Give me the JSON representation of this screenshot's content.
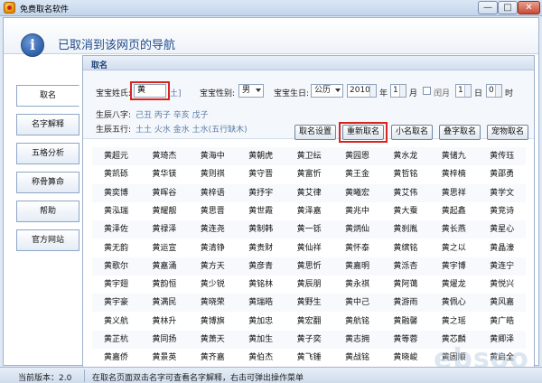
{
  "window": {
    "title": "免费取名软件",
    "icon": "app-logo-icon",
    "controls": [
      "—",
      "□",
      "✕"
    ]
  },
  "nav_banner": {
    "message": "已取消到该网页的导航",
    "icon": "info-icon",
    "icon_glyph": "i"
  },
  "sidebar": {
    "items": [
      {
        "label": "取名",
        "active": true
      },
      {
        "label": "名字解释",
        "active": false
      },
      {
        "label": "五格分析",
        "active": false
      },
      {
        "label": "称骨算命",
        "active": false
      },
      {
        "label": "帮助",
        "active": false
      },
      {
        "label": "官方网站",
        "active": false
      }
    ]
  },
  "panel": {
    "title": "取名",
    "surname_label": "宝宝姓氏:",
    "surname_value": "黄",
    "surname_hint": "土]",
    "gender_label": "宝宝性别:",
    "gender_value": "男",
    "birth_label": "宝宝生日:",
    "calendar_value": "公历",
    "year_value": "2010",
    "year_unit": "年",
    "month_value": "1",
    "month_unit": "月",
    "leap_label": "闰月",
    "day_value": "1",
    "day_unit": "日",
    "hour_value": "0",
    "hour_unit": "时",
    "bazi_label": "生辰八字:",
    "bazi_value": "己丑 丙子 辛亥 戊子",
    "wuxing_label": "生辰五行:",
    "wuxing_value": "土土 火水 金水 土水(五行缺木)",
    "buttons": [
      "取名设置",
      "重新取名",
      "小名取名",
      "叠字取名",
      "宠物取名"
    ],
    "highlighted_button": "重新取名"
  },
  "names": [
    [
      "黄超元",
      "黄琦杰",
      "黄海中",
      "黄朝虎",
      "黄卫纭",
      "黄园恩",
      "黄水龙",
      "黄储九",
      "黄传珏"
    ],
    [
      "黄凯砾",
      "黄华镁",
      "黄则祺",
      "黄守晋",
      "黄富忻",
      "黄王金",
      "黄哲铭",
      "黄梓楠",
      "黄邵勇"
    ],
    [
      "黄奕博",
      "黄晖谷",
      "黄梓语",
      "黄抒宇",
      "黄艾律",
      "黄曦宏",
      "黄艾伟",
      "黄思祥",
      "黄学文"
    ],
    [
      "黄泓瑞",
      "黄耀靓",
      "黄思晋",
      "黄世霞",
      "黄泽嘉",
      "黄兆中",
      "黄大蚕",
      "黄起鑫",
      "黄竞诗"
    ],
    [
      "黄泽佐",
      "黄禄泽",
      "黄连尧",
      "黄制韩",
      "黄一铄",
      "黄炳仙",
      "黄刹胤",
      "黄长燕",
      "黄星心"
    ],
    [
      "黄无韵",
      "黄运宣",
      "黄清铮",
      "黄贵财",
      "黄仙祥",
      "黄怀泰",
      "黄缤铭",
      "黄之以",
      "黄晶濠"
    ],
    [
      "黄歌尔",
      "黄嘉涌",
      "黄方天",
      "黄彦青",
      "黄思忻",
      "黄嘉明",
      "黄泺杏",
      "黄宇博",
      "黄连宁"
    ],
    [
      "黄宇翅",
      "黄韵恒",
      "黄少锐",
      "黄铭林",
      "黄辰朋",
      "黄永祺",
      "黄阿蔼",
      "黄燿龙",
      "黄悦兴"
    ],
    [
      "黄宇豪",
      "黄满民",
      "黄晓荣",
      "黄瑞皓",
      "黄野生",
      "黄中己",
      "黄游雨",
      "黄佩心",
      "黄风嘉"
    ],
    [
      "黄义航",
      "黄林升",
      "黄博旗",
      "黄加忠",
      "黄宏翻",
      "黄航铭",
      "黄融馨",
      "黄之瑶",
      "黄广皓"
    ],
    [
      "黄芷杭",
      "黄同扬",
      "黄萧天",
      "黄加生",
      "黄子奕",
      "黄志拥",
      "黄等蓉",
      "黄芯麟",
      "黄卿泽"
    ],
    [
      "黄嘉侨",
      "黄景英",
      "黄齐嘉",
      "黄伯杰",
      "黄飞锤",
      "黄战铭",
      "黄晓峻",
      "黄固顺",
      "黄启全"
    ]
  ],
  "statusbar": {
    "version": "当前版本：2.0",
    "tip": "在取名页面双击名字可查看名字解释，右击可弹出操作菜单"
  },
  "watermark": "ebsoo"
}
